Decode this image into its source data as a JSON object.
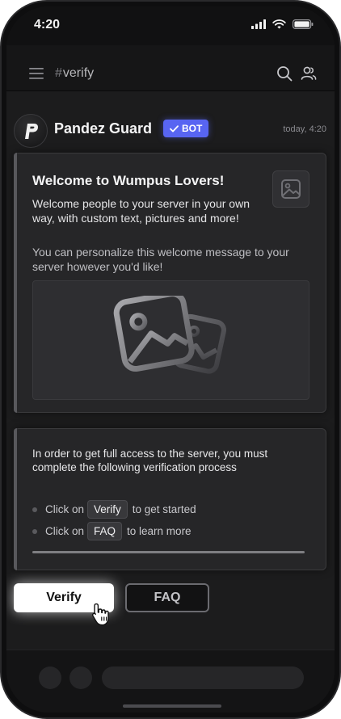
{
  "status_bar": {
    "time": "4:20"
  },
  "header": {
    "channel_hash": "#",
    "channel_name": "verify"
  },
  "message": {
    "author": "Pandez Guard",
    "badge": "BOT",
    "timestamp": "today, 4:20"
  },
  "welcome_embed": {
    "title": "Welcome to Wumpus Lovers!",
    "description": "Welcome people to your server in your own way, with custom text, pictures and more!",
    "subtext": "You can personalize this welcome message to your server however you'd like!"
  },
  "verification_embed": {
    "text": "In order to get full access to the server, you must complete the following verification process",
    "step1": {
      "prefix": "Click on",
      "chip": "Verify",
      "suffix": "to get started"
    },
    "step2": {
      "prefix": "Click on",
      "chip": "FAQ",
      "suffix": "to learn more"
    }
  },
  "buttons": {
    "verify_label": "Verify",
    "faq_label": "FAQ"
  },
  "colors": {
    "blurple": "#5865f2",
    "background": "#1c1c1d"
  }
}
